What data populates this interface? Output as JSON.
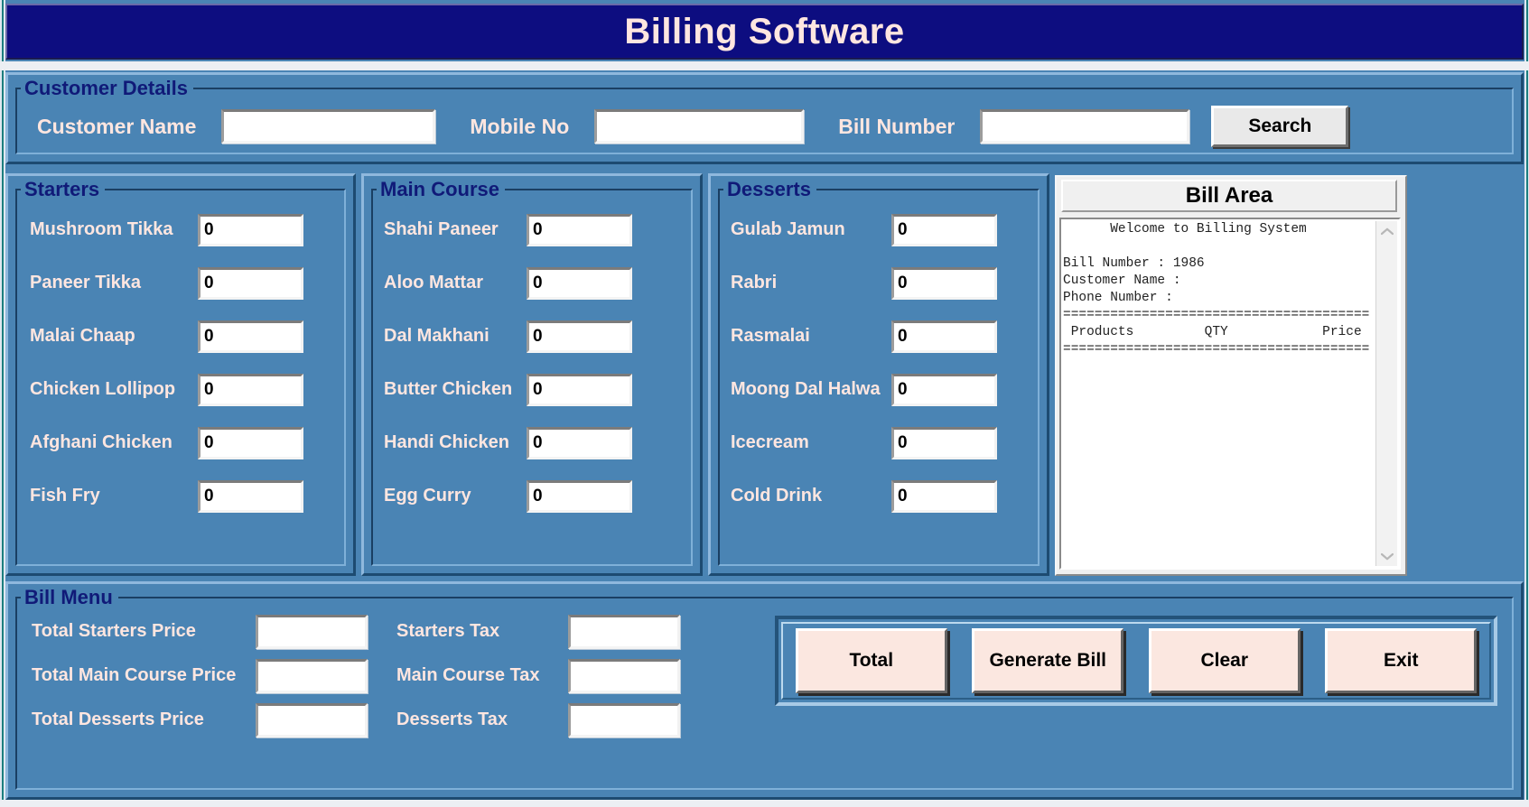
{
  "window": {
    "title": "Billing Software"
  },
  "customer_details": {
    "legend": "Customer Details",
    "name_label": "Customer Name",
    "name_value": "",
    "mobile_label": "Mobile No",
    "mobile_value": "",
    "bill_number_label": "Bill Number",
    "bill_number_value": "",
    "search_label": "Search"
  },
  "categories": [
    {
      "legend": "Starters",
      "items": [
        {
          "label": "Mushroom Tikka",
          "qty": "0"
        },
        {
          "label": "Paneer Tikka",
          "qty": "0"
        },
        {
          "label": "Malai Chaap",
          "qty": "0"
        },
        {
          "label": "Chicken Lollipop",
          "qty": "0"
        },
        {
          "label": "Afghani Chicken",
          "qty": "0"
        },
        {
          "label": "Fish Fry",
          "qty": "0"
        }
      ]
    },
    {
      "legend": "Main Course",
      "items": [
        {
          "label": "Shahi Paneer",
          "qty": "0"
        },
        {
          "label": "Aloo Mattar",
          "qty": "0"
        },
        {
          "label": "Dal Makhani",
          "qty": "0"
        },
        {
          "label": "Butter Chicken",
          "qty": "0"
        },
        {
          "label": "Handi Chicken",
          "qty": "0"
        },
        {
          "label": "Egg Curry",
          "qty": "0"
        }
      ]
    },
    {
      "legend": "Desserts",
      "items": [
        {
          "label": "Gulab Jamun",
          "qty": "0"
        },
        {
          "label": "Rabri",
          "qty": "0"
        },
        {
          "label": "Rasmalai",
          "qty": "0"
        },
        {
          "label": "Moong Dal Halwa",
          "qty": "0"
        },
        {
          "label": "Icecream",
          "qty": "0"
        },
        {
          "label": "Cold Drink",
          "qty": "0"
        }
      ]
    }
  ],
  "bill_area": {
    "title": "Bill Area",
    "text": "      Welcome to Billing System\n\nBill Number : 1986\nCustomer Name :\nPhone Number :\n=======================================\n Products         QTY            Price\n=======================================",
    "scroll_up_icon": "chevron-up-icon",
    "scroll_down_icon": "chevron-down-icon"
  },
  "bill_menu": {
    "legend": "Bill Menu",
    "rows": [
      {
        "price_label": "Total Starters Price",
        "price_value": "",
        "tax_label": "Starters Tax",
        "tax_value": ""
      },
      {
        "price_label": "Total Main Course Price",
        "price_value": "",
        "tax_label": "Main Course Tax",
        "tax_value": ""
      },
      {
        "price_label": "Total Desserts Price",
        "price_value": "",
        "tax_label": "Desserts Tax",
        "tax_value": ""
      }
    ],
    "buttons": [
      {
        "label": "Total"
      },
      {
        "label": "Generate Bill"
      },
      {
        "label": "Clear"
      },
      {
        "label": "Exit"
      }
    ]
  },
  "colors": {
    "window_background": "#4a84b4",
    "titlebar_background": "#0d0d80",
    "titlebar_text": "#ffe6e0",
    "legend_text": "#101a78",
    "label_text": "#ffe6e0",
    "action_button_face": "#fbe7e0",
    "field_background": "#ffffff"
  }
}
